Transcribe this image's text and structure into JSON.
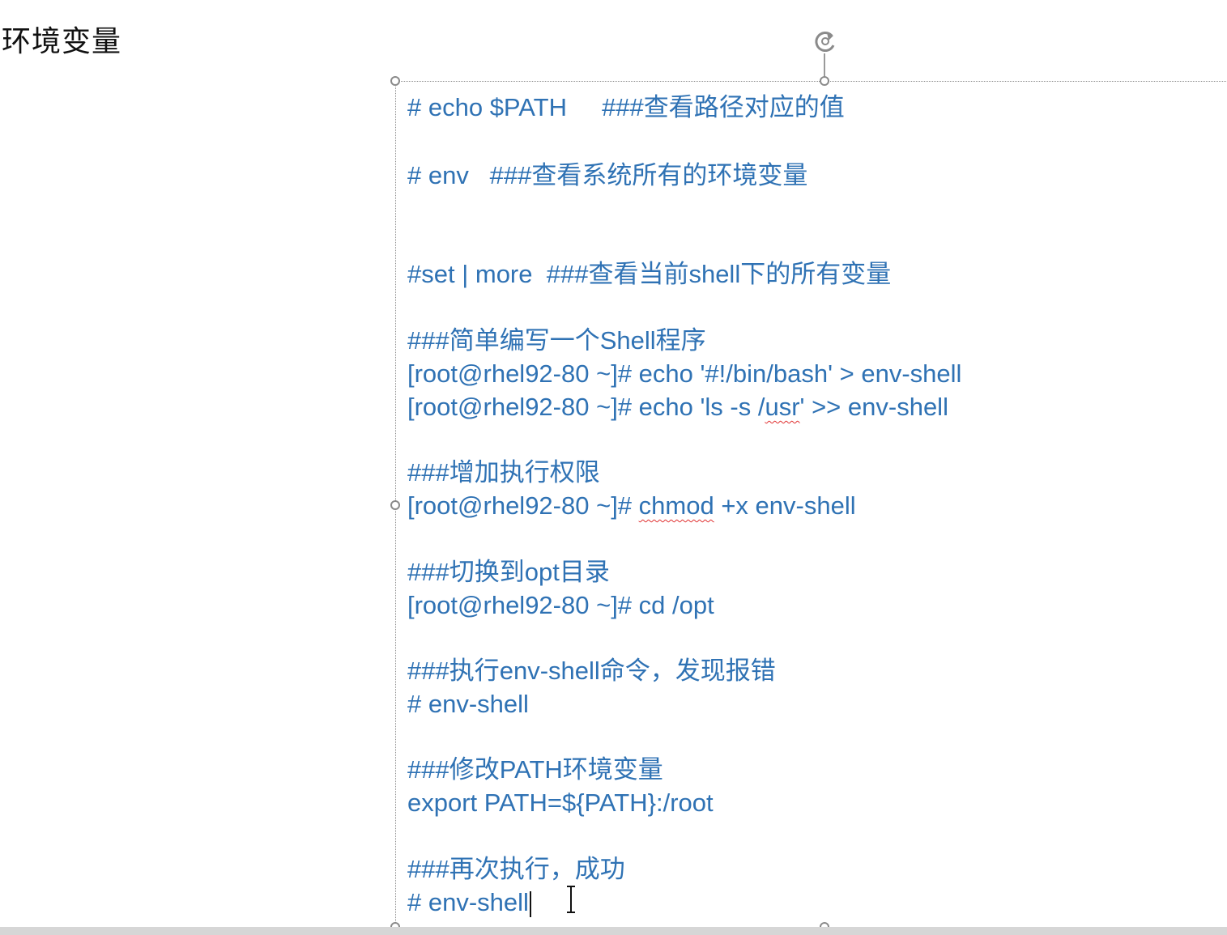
{
  "slide": {
    "title": "环境变量"
  },
  "textbox": {
    "l1": "# echo $PATH     ###查看路径对应的值",
    "l2": "# env   ###查看系统所有的环境变量",
    "l3": "#set | more  ###查看当前shell下的所有变量",
    "l4": "###简单编写一个Shell程序",
    "l5": "[root@rhel92-80 ~]# echo '#!/bin/bash' > env-shell",
    "l6a": "[root@rhel92-80 ~]# echo 'ls -s /",
    "l6b": "usr",
    "l6c": "' >> env-shell",
    "l7": "###增加执行权限",
    "l8a": "[root@rhel92-80 ~]# ",
    "l8b": "chmod",
    "l8c": " +x env-shell",
    "l9": "###切换到opt目录",
    "l10": "[root@rhel92-80 ~]# cd /opt",
    "l11": "###执行env-shell命令，发现报错",
    "l12": "# env-shell",
    "l13": "###修改PATH环境变量",
    "l14": "export PATH=${PATH}:/root",
    "l15": "###再次执行，成功",
    "l16": "# env-shell"
  },
  "icons": {
    "rotate": "rotate-handle-icon",
    "cursor": "text-cursor-icon"
  },
  "colors": {
    "text": "#2f72b4",
    "title": "#111111",
    "spellcheck": "#e03030"
  }
}
